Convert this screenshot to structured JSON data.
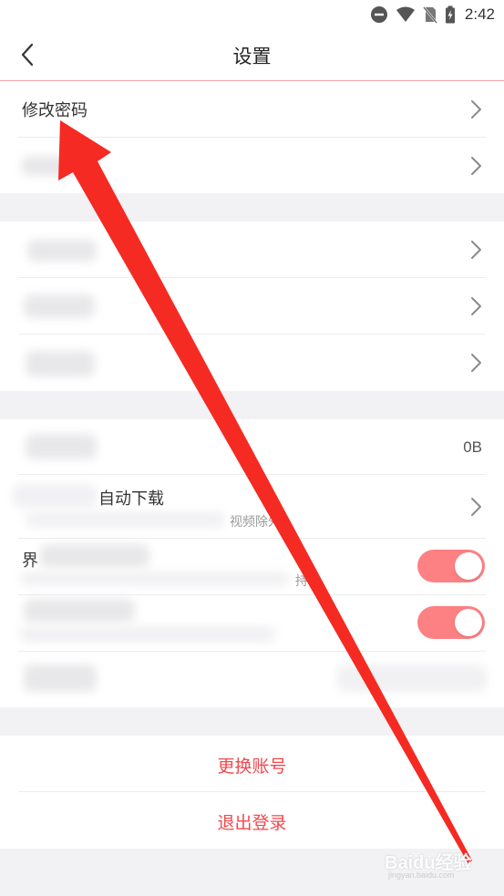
{
  "status_bar": {
    "time": "2:42",
    "icons": [
      "do-not-disturb-icon",
      "wifi-icon",
      "no-sim-icon",
      "battery-charging-icon"
    ]
  },
  "nav": {
    "title": "设置",
    "back_icon": "chevron-left-icon"
  },
  "group1": {
    "items": [
      {
        "label": "修改密码",
        "chevron": true
      },
      {
        "label": "",
        "chevron": true
      }
    ]
  },
  "group2": {
    "items": [
      {
        "label": "",
        "chevron": true
      },
      {
        "label": "",
        "chevron": true
      },
      {
        "label": "",
        "chevron": true
      }
    ]
  },
  "group3": {
    "cache": {
      "label": "",
      "value": "0B"
    },
    "auto_download": {
      "title_visible": "自动下载",
      "subtitle_visible": "视频除外",
      "chevron": true
    },
    "setting_a": {
      "title_visible": "界",
      "subtitle_visible": "持",
      "toggle_on": true
    },
    "setting_b": {
      "title_visible": "",
      "toggle_on": true
    },
    "setting_c": {
      "label": "",
      "value": ""
    }
  },
  "actions": {
    "switch_account": "更换账号",
    "logout": "退出登录"
  },
  "colors": {
    "accent": "#f2484d",
    "toggle_on": "#fd8082",
    "annotation_arrow": "#f52a22"
  },
  "watermark": {
    "brand": "Baidu经验",
    "url": "jingyan.baidu.com"
  }
}
